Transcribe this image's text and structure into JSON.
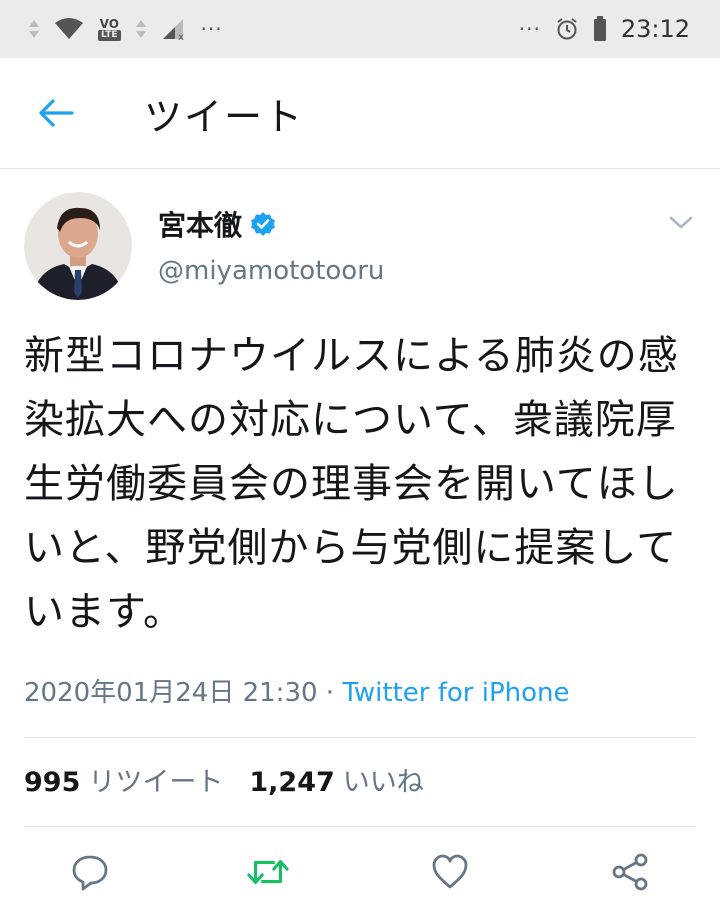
{
  "status_bar": {
    "time": "23:12",
    "dots_left": "···",
    "dots_right": "···",
    "network_label_top": "VO",
    "network_label_bottom": "LTE"
  },
  "header": {
    "title": "ツイート",
    "back_icon": "arrow-left-icon"
  },
  "tweet": {
    "author": {
      "display_name": "宮本徹",
      "handle": "@miyamototooru",
      "verified": true
    },
    "text": "新型コロナウイルスによる肺炎の感染拡大への対応について、衆議院厚生労働委員会の理事会を開いてほしいと、野党側から与党側に提案しています。",
    "timestamp": "2020年01月24日 21:30",
    "separator": " · ",
    "source": "Twitter for iPhone",
    "retweet_count": "995",
    "retweet_label": "リツイート",
    "like_count": "1,247",
    "like_label": "いいね"
  },
  "actions": [
    {
      "name": "reply",
      "icon": "comment-icon"
    },
    {
      "name": "retweet",
      "icon": "retweet-icon"
    },
    {
      "name": "like",
      "icon": "heart-icon"
    },
    {
      "name": "share",
      "icon": "share-icon"
    }
  ],
  "colors": {
    "accent": "#1da1f2",
    "retweet_green": "#17bf63",
    "secondary_text": "#657786",
    "status_bar_bg": "#ebebeb"
  }
}
